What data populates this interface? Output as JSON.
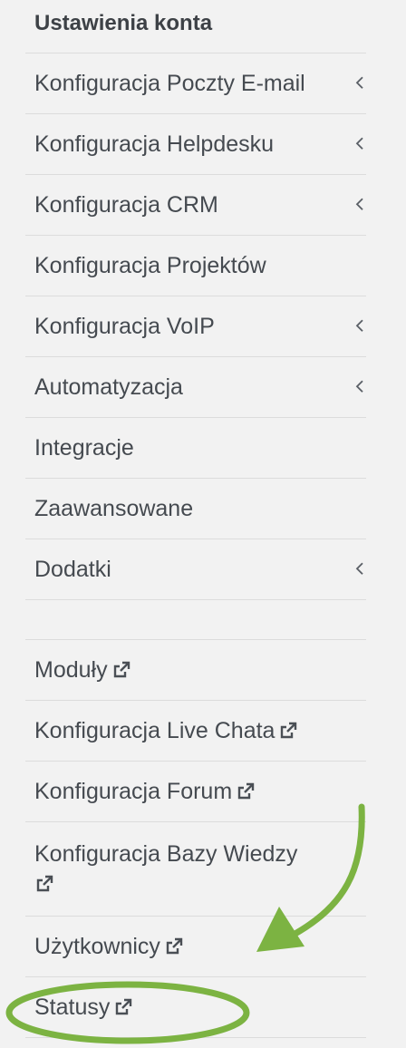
{
  "menu": {
    "header": "Ustawienia konta",
    "items": [
      {
        "label": "Konfiguracja Poczty E-mail",
        "icon": "chevron-left-icon"
      },
      {
        "label": "Konfiguracja Helpdesku",
        "icon": "chevron-left-icon"
      },
      {
        "label": "Konfiguracja CRM",
        "icon": "chevron-left-icon"
      },
      {
        "label": "Konfiguracja Projektów"
      },
      {
        "label": "Konfiguracja VoIP",
        "icon": "chevron-left-icon"
      },
      {
        "label": "Automatyzacja",
        "icon": "chevron-left-icon"
      },
      {
        "label": "Integracje"
      },
      {
        "label": "Zaawansowane"
      },
      {
        "label": "Dodatki",
        "icon": "chevron-left-icon"
      }
    ],
    "external_items": [
      {
        "label": "Moduły",
        "icon": "external-link-icon"
      },
      {
        "label": "Konfiguracja Live Chata",
        "icon": "external-link-icon"
      },
      {
        "label": "Konfiguracja Forum",
        "icon": "external-link-icon"
      },
      {
        "label": "Konfiguracja Bazy Wiedzy",
        "icon": "external-link-icon"
      },
      {
        "label": "Użytkownicy",
        "icon": "external-link-icon"
      },
      {
        "label": "Statusy",
        "icon": "external-link-icon"
      }
    ]
  },
  "colors": {
    "background": "#f2f2f2",
    "text": "#454a50",
    "divider": "#dcdcdc",
    "annotation": "#7cb342"
  }
}
